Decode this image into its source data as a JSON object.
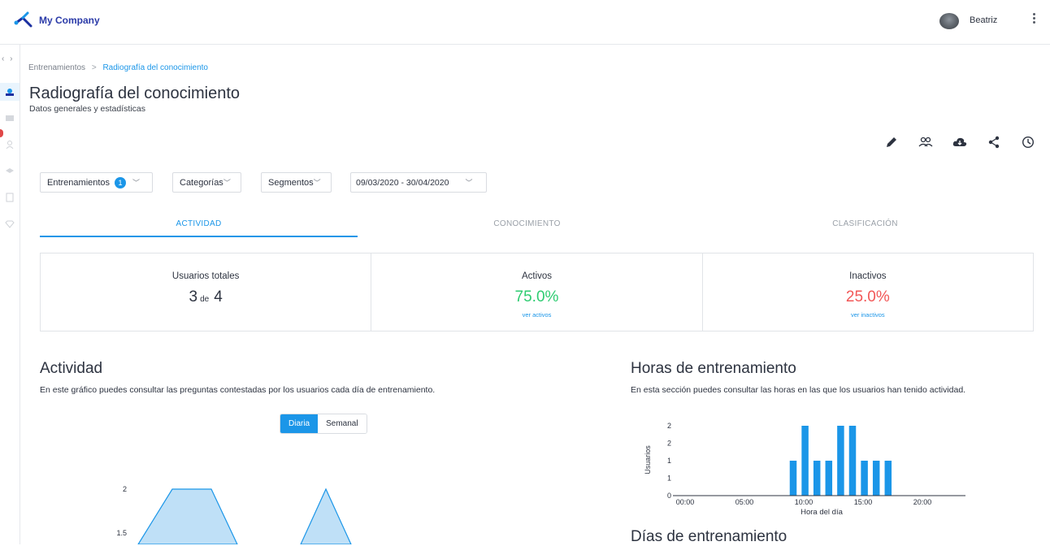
{
  "app": {
    "company": "My Company",
    "user": "Beatriz"
  },
  "breadcrumb": {
    "parent": "Entrenamientos",
    "separator": ">",
    "current": "Radiografía del conocimiento"
  },
  "page": {
    "title": "Radiografía del conocimiento",
    "subtitle": "Datos generales y estadísticas"
  },
  "toolbar": {
    "icons": [
      "edit-icon",
      "users-icon",
      "cloud-download-icon",
      "share-icon",
      "history-icon"
    ]
  },
  "filters": {
    "trainings": {
      "label": "Entrenamientos",
      "count": "1"
    },
    "categories": {
      "label": "Categorías"
    },
    "segments": {
      "label": "Segmentos"
    },
    "date_range": {
      "value": "09/03/2020 - 30/04/2020"
    }
  },
  "tabs": [
    {
      "label": "ACTIVIDAD",
      "active": true
    },
    {
      "label": "CONOCIMIENTO",
      "active": false
    },
    {
      "label": "CLASIFICACIÓN",
      "active": false
    }
  ],
  "stats": {
    "total": {
      "label": "Usuarios totales",
      "value": "3",
      "of": "de",
      "total": "4"
    },
    "active": {
      "label": "Activos",
      "value": "75.0%",
      "link": "ver activos",
      "color": "#2ecc71"
    },
    "inactive": {
      "label": "Inactivos",
      "value": "25.0%",
      "link": "ver inactivos",
      "color": "#f25757"
    }
  },
  "activity": {
    "title": "Actividad",
    "description": "En este gráfico puedes consultar las preguntas contestadas por los usuarios cada día de entrenamiento.",
    "toggle": {
      "daily": "Diaria",
      "weekly": "Semanal"
    }
  },
  "hours": {
    "title": "Horas de entrenamiento",
    "description": "En esta sección puedes consultar las horas en las que los usuarios han tenido actividad."
  },
  "days": {
    "title": "Días de entrenamiento"
  },
  "chart_data": [
    {
      "type": "bar",
      "x_hours": [
        10,
        11,
        12,
        13,
        14,
        15,
        16,
        17,
        18
      ],
      "values": [
        1,
        2,
        1,
        1,
        2,
        2,
        1,
        1,
        1
      ],
      "xlabel": "Hora del día",
      "ylabel": "Usuarios",
      "xtick_labels": [
        "00:00",
        "05:00",
        "10:00",
        "15:00",
        "20:00"
      ],
      "ytick_labels": [
        "0",
        "1",
        "1",
        "2",
        "2"
      ],
      "color": "#1b96e8"
    },
    {
      "type": "area",
      "ytick_labels": [
        "2",
        "1.5"
      ],
      "peaks": [
        2,
        2,
        2
      ],
      "color": "#1b96e8"
    }
  ]
}
